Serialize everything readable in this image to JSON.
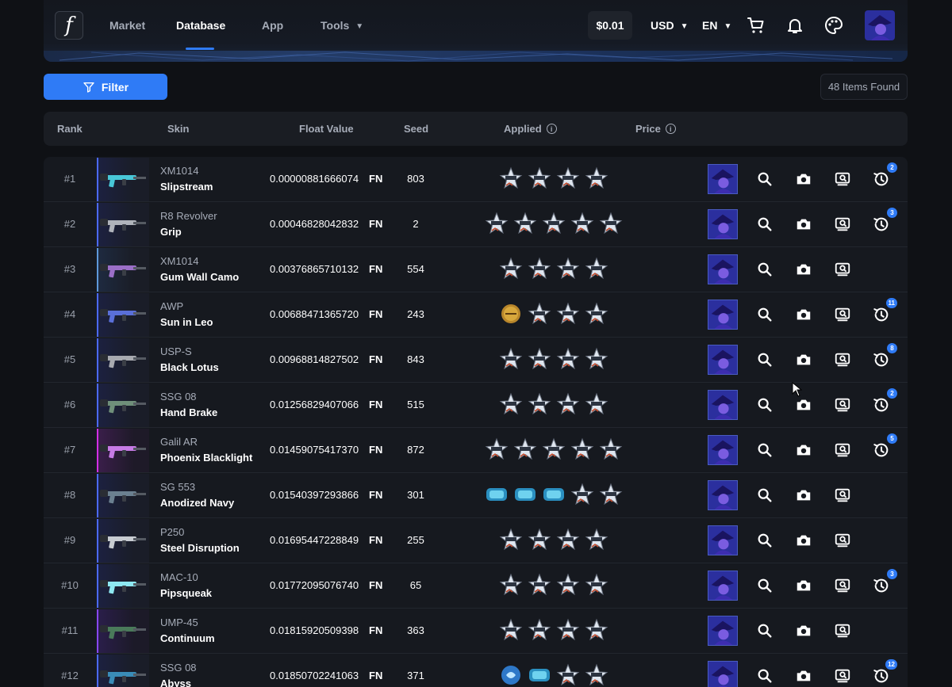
{
  "header": {
    "logo": "f",
    "nav": [
      {
        "label": "Market"
      },
      {
        "label": "Database"
      },
      {
        "label": "App"
      },
      {
        "label": "Tools"
      }
    ],
    "balance": "$0.01",
    "currency": "USD",
    "language": "EN"
  },
  "toolbar": {
    "filter_label": "Filter",
    "items_found": "48 Items Found"
  },
  "columns": {
    "rank": "Rank",
    "skin": "Skin",
    "float": "Float Value",
    "seed": "Seed",
    "applied": "Applied",
    "price": "Price"
  },
  "rows": [
    {
      "rank": "#1",
      "type": "XM1014",
      "name": "Slipstream",
      "float": "0.00000881666074",
      "wear": "FN",
      "seed": "803",
      "history": "2"
    },
    {
      "rank": "#2",
      "type": "R8 Revolver",
      "name": "Grip",
      "float": "0.00046828042832",
      "wear": "FN",
      "seed": "2",
      "history": "3"
    },
    {
      "rank": "#3",
      "type": "XM1014",
      "name": "Gum Wall Camo",
      "float": "0.00376865710132",
      "wear": "FN",
      "seed": "554",
      "history": ""
    },
    {
      "rank": "#4",
      "type": "AWP",
      "name": "Sun in Leo",
      "float": "0.00688471365720",
      "wear": "FN",
      "seed": "243",
      "history": "11"
    },
    {
      "rank": "#5",
      "type": "USP-S",
      "name": "Black Lotus",
      "float": "0.00968814827502",
      "wear": "FN",
      "seed": "843",
      "history": "8"
    },
    {
      "rank": "#6",
      "type": "SSG 08",
      "name": "Hand Brake",
      "float": "0.01256829407066",
      "wear": "FN",
      "seed": "515",
      "history": "2"
    },
    {
      "rank": "#7",
      "type": "Galil AR",
      "name": "Phoenix Blacklight",
      "float": "0.01459075417370",
      "wear": "FN",
      "seed": "872",
      "history": "5"
    },
    {
      "rank": "#8",
      "type": "SG 553",
      "name": "Anodized Navy",
      "float": "0.01540397293866",
      "wear": "FN",
      "seed": "301",
      "history": ""
    },
    {
      "rank": "#9",
      "type": "P250",
      "name": "Steel Disruption",
      "float": "0.01695447228849",
      "wear": "FN",
      "seed": "255",
      "history": ""
    },
    {
      "rank": "#10",
      "type": "MAC-10",
      "name": "Pipsqueak",
      "float": "0.01772095076740",
      "wear": "FN",
      "seed": "65",
      "history": "3"
    },
    {
      "rank": "#11",
      "type": "UMP-45",
      "name": "Continuum",
      "float": "0.01815920509398",
      "wear": "FN",
      "seed": "363",
      "history": ""
    },
    {
      "rank": "#12",
      "type": "SSG 08",
      "name": "Abyss",
      "float": "0.01850702241063",
      "wear": "FN",
      "seed": "371",
      "history": "12"
    }
  ],
  "colors": {
    "accent": "#2f7bf6",
    "background": "#0f1115",
    "row": "#16191f"
  }
}
